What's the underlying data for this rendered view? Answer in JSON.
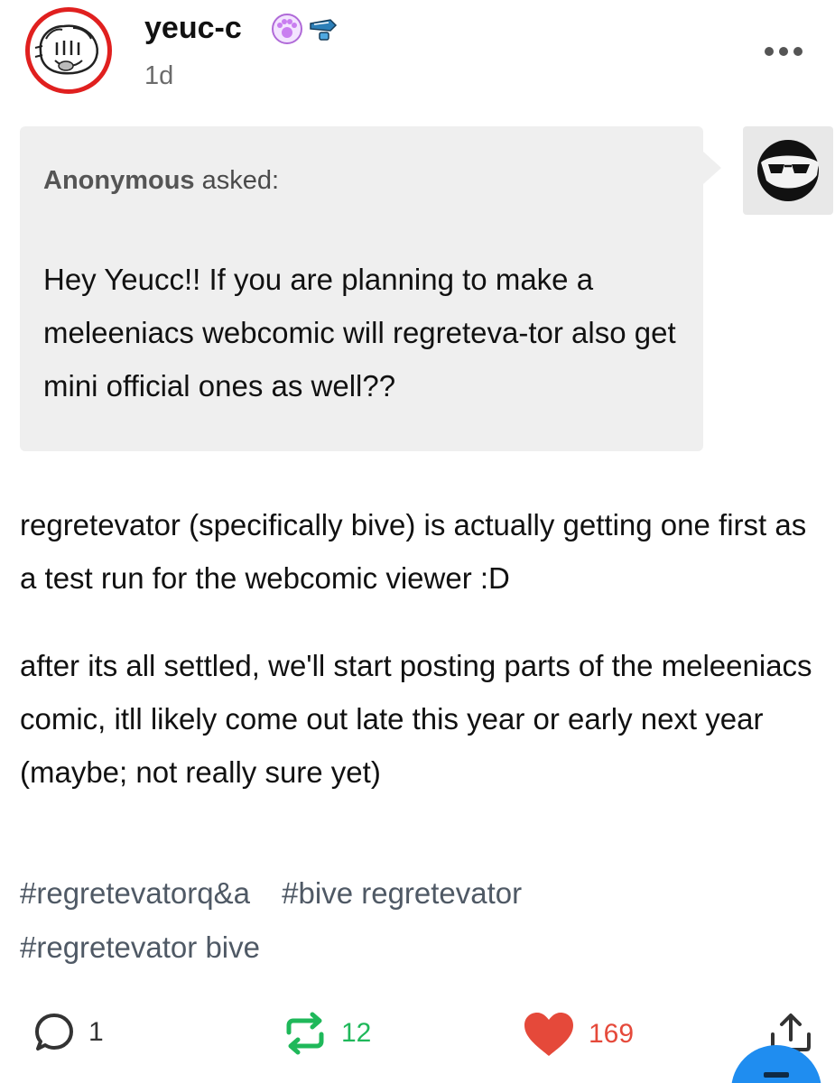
{
  "post": {
    "username": "yeuc-c",
    "timestamp": "1d",
    "ask": {
      "asker": "Anonymous",
      "asked_label": "asked:",
      "question": "Hey Yeucc!! If you are planning to make a meleeniacs webcomic will regreteva-tor also get mini official ones as well??"
    },
    "answer_paragraphs": [
      "regretevator (specifically bive) is actually getting one first as a test run for the webcomic viewer :D",
      "after its all settled, we'll start posting parts of the meleeniacs comic, itll likely come out late this year or early next year (maybe; not really sure yet)"
    ],
    "tags": [
      "#regretevatorq&a",
      "#bive regretevator",
      "#regretevator bive"
    ],
    "counts": {
      "replies": "1",
      "reblogs": "12",
      "likes": "169"
    }
  },
  "icons": {
    "more": "more-options-icon",
    "reply": "speech-bubble-icon",
    "reblog": "reblog-icon",
    "like": "heart-icon",
    "share": "share-icon",
    "badge_1": "paw-badge-icon",
    "badge_2": "fish-badge-icon"
  },
  "colors": {
    "avatar_ring": "#e0201f",
    "reblog": "#1fb85a",
    "like": "#e5493a",
    "tag": "#4f5965",
    "fab": "#1f8df0",
    "ask_bg": "#efefef"
  }
}
